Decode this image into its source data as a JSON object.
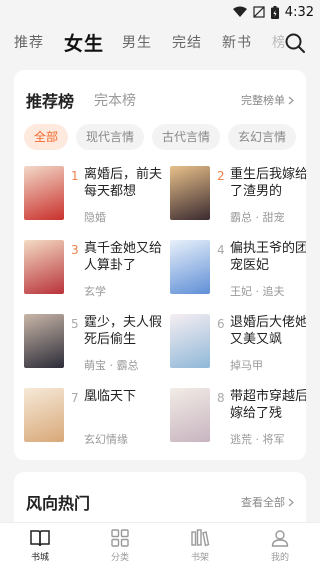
{
  "status": {
    "time": "4:32"
  },
  "top_nav": {
    "tabs": [
      {
        "label": "推荐"
      },
      {
        "label": "女生"
      },
      {
        "label": "男生"
      },
      {
        "label": "完结"
      },
      {
        "label": "新书"
      },
      {
        "label": "榜"
      }
    ],
    "active_index": 1
  },
  "ranking": {
    "title": "推荐榜",
    "subtab": "完本榜",
    "more": "完整榜单",
    "chips": [
      {
        "label": "全部"
      },
      {
        "label": "现代言情"
      },
      {
        "label": "古代言情"
      },
      {
        "label": "玄幻言情"
      }
    ],
    "books": [
      {
        "rank": "1",
        "title": "离婚后，前夫每天都想",
        "meta": "隐婚",
        "cover_colors": [
          "#c9302c",
          "#f2d9c8"
        ]
      },
      {
        "rank": "2",
        "title": "重生后我嫁给了渣男的",
        "meta": "霸总 · 甜宠",
        "cover_colors": [
          "#3a2a30",
          "#e8c08a"
        ]
      },
      {
        "rank": "3",
        "title": "真千金她又给人算卦了",
        "meta": "玄学",
        "cover_colors": [
          "#b8323a",
          "#f4dcc4"
        ]
      },
      {
        "rank": "4",
        "title": "偏执王爷的团宠医妃",
        "meta": "王妃 · 追夫",
        "cover_colors": [
          "#5f8fd6",
          "#e8f0fa"
        ]
      },
      {
        "rank": "5",
        "title": "霆少，夫人假死后偷生",
        "meta": "萌宝 · 霸总",
        "cover_colors": [
          "#2c2c38",
          "#c9b6a8"
        ]
      },
      {
        "rank": "6",
        "title": "退婚后大佬她又美又飒",
        "meta": "掉马甲",
        "cover_colors": [
          "#8fb8d8",
          "#f6eef2"
        ]
      },
      {
        "rank": "7",
        "title": "凰临天下",
        "meta": "玄幻情缘",
        "cover_colors": [
          "#d8a878",
          "#f6e9d8"
        ]
      },
      {
        "rank": "8",
        "title": "带超市穿越后嫁给了残",
        "meta": "逃荒 · 将军",
        "cover_colors": [
          "#c8b4c0",
          "#f2ece6"
        ]
      }
    ]
  },
  "trending": {
    "title": "风向热门",
    "more": "查看全部"
  },
  "bottom_nav": {
    "items": [
      {
        "label": "书城",
        "icon": "book-open-icon"
      },
      {
        "label": "分类",
        "icon": "grid-icon"
      },
      {
        "label": "书架",
        "icon": "bookshelf-icon"
      },
      {
        "label": "我的",
        "icon": "user-icon"
      }
    ]
  },
  "colors": {
    "accent": "#f06a2e",
    "rank_top": "#f0824a"
  }
}
